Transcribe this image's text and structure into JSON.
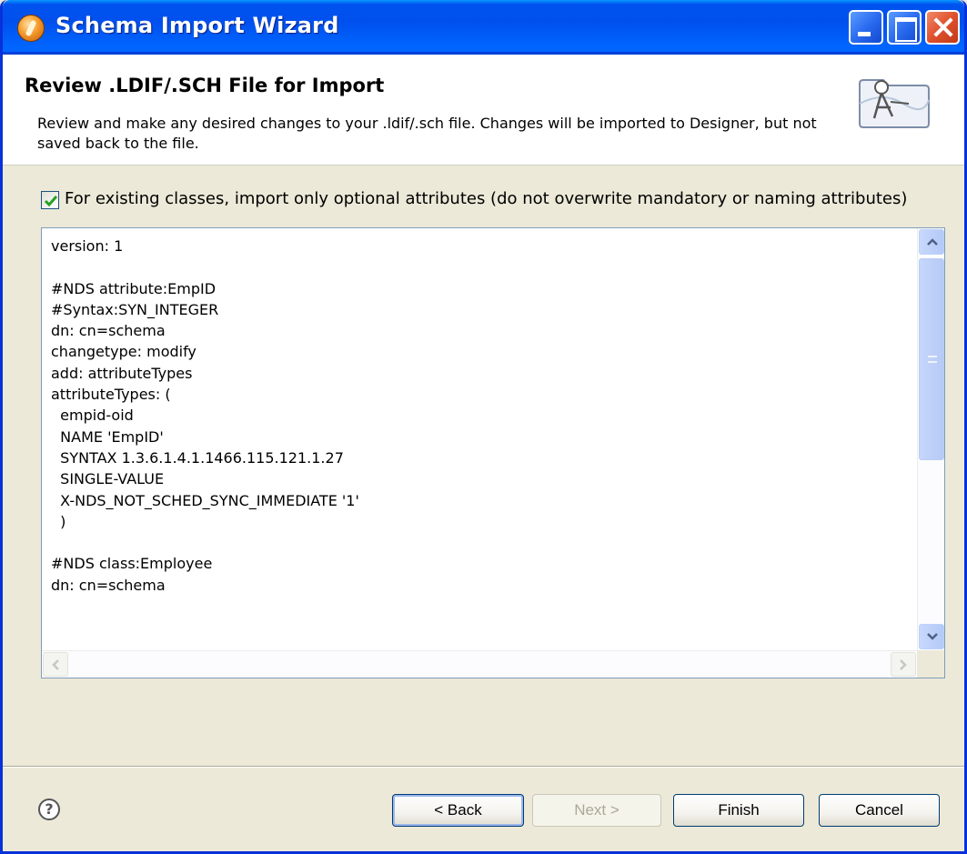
{
  "window": {
    "title": "Schema Import Wizard"
  },
  "header": {
    "title": "Review .LDIF/.SCH File for Import",
    "description": "Review and make any desired changes to your .ldif/.sch file.  Changes will be imported to Designer, but not saved back to the file.",
    "graphic_icon": "wizard-banner-icon"
  },
  "options": {
    "optional_attributes_checked": true,
    "optional_attributes_label": "For existing classes, import only optional attributes (do not overwrite mandatory or naming attributes)"
  },
  "editor": {
    "lines": [
      "version: 1",
      "",
      "#NDS attribute:EmpID",
      "#Syntax:SYN_INTEGER",
      "dn: cn=schema",
      "changetype: modify",
      "add: attributeTypes",
      "attributeTypes: (",
      "  empid-oid",
      "  NAME 'EmpID'",
      "  SYNTAX 1.3.6.1.4.1.1466.115.121.1.27",
      "  SINGLE-VALUE",
      "  X-NDS_NOT_SCHED_SYNC_IMMEDIATE '1'",
      "  )",
      "",
      "#NDS class:Employee",
      "dn: cn=schema"
    ]
  },
  "buttons": {
    "help_label": "?",
    "back_label": "< Back",
    "next_label": "Next >",
    "finish_label": "Finish",
    "cancel_label": "Cancel"
  },
  "colors": {
    "titlebar": "#0053ee",
    "window_bg": "#ece9d8",
    "close_button": "#e0502c"
  }
}
